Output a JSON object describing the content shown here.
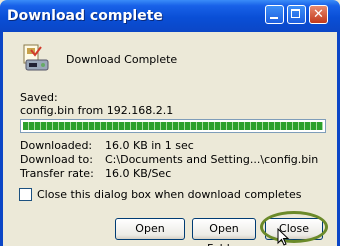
{
  "window": {
    "title": "Download complete"
  },
  "heading": "Download Complete",
  "saved_label": "Saved:",
  "saved_file": "config.bin from 192.168.2.1",
  "progress": 1.0,
  "details": {
    "downloaded_label": "Downloaded:",
    "downloaded_value": "16.0 KB in 1 sec",
    "download_to_label": "Download to:",
    "download_to_value": "C:\\Documents and Setting...\\config.bin",
    "transfer_rate_label": "Transfer rate:",
    "transfer_rate_value": "16.0 KB/Sec"
  },
  "close_checkbox_label": "Close this dialog box when download completes",
  "close_checkbox_checked": false,
  "buttons": {
    "open": "Open",
    "open_folder": "Open Folder",
    "close": "Close"
  },
  "icons": {
    "title_minimize": "minimize-icon",
    "title_maximize": "maximize-icon",
    "title_close": "close-icon",
    "download": "download-file-icon",
    "cursor": "mouse-pointer-icon"
  },
  "colors": {
    "titlebar": "#0b46c6",
    "progress": "#2ca02c",
    "dialog_bg": "#ece9d8",
    "highlight": "#6b8a2a"
  }
}
